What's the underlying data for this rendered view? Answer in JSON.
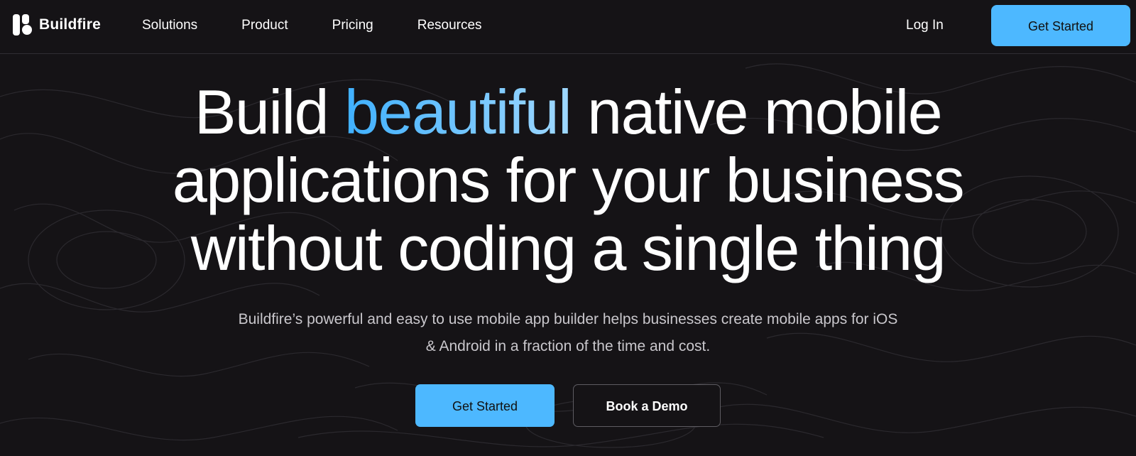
{
  "brand": {
    "name": "Buildfire",
    "accent_color": "#4db8ff",
    "background_color": "#151316"
  },
  "nav": {
    "links": [
      "Solutions",
      "Product",
      "Pricing",
      "Resources"
    ],
    "login_label": "Log In",
    "cta_label": "Get Started"
  },
  "hero": {
    "headline_before": "Build ",
    "headline_accent": "beautiful",
    "headline_after": " native mobile applications for your business without coding a single thing",
    "subtitle": "Buildfire’s powerful and easy to use mobile app builder helps businesses create mobile apps for iOS & Android in a fraction of the time and cost.",
    "primary_cta": "Get Started",
    "secondary_cta": "Book a Demo"
  },
  "icons": {
    "logo": "buildfire-logo-icon"
  }
}
